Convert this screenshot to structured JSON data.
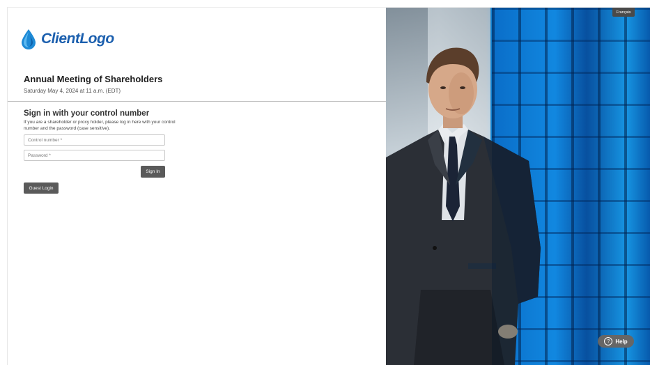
{
  "branding": {
    "logo_text": "ClientLogo",
    "logo_color": "#1b5fae",
    "drop_color": "#1e8ad6"
  },
  "meeting": {
    "title": "Annual Meeting of Shareholders",
    "datetime": "Saturday May 4, 2024 at 11 a.m. (EDT)"
  },
  "signin": {
    "heading": "Sign in with your control number",
    "description": "If you are a shareholder or proxy holder, please log in here with your control number and the password (case sensitive).",
    "control_placeholder": "Control number *",
    "password_placeholder": "Password *",
    "signin_label": "Sign In",
    "guest_label": "Guest Login"
  },
  "language": {
    "label": "Français"
  },
  "help": {
    "label": "Help",
    "icon": "question-circle-icon"
  },
  "colors": {
    "button_bg": "#5a5a5a",
    "accent_blue": "#1aa6ef"
  }
}
